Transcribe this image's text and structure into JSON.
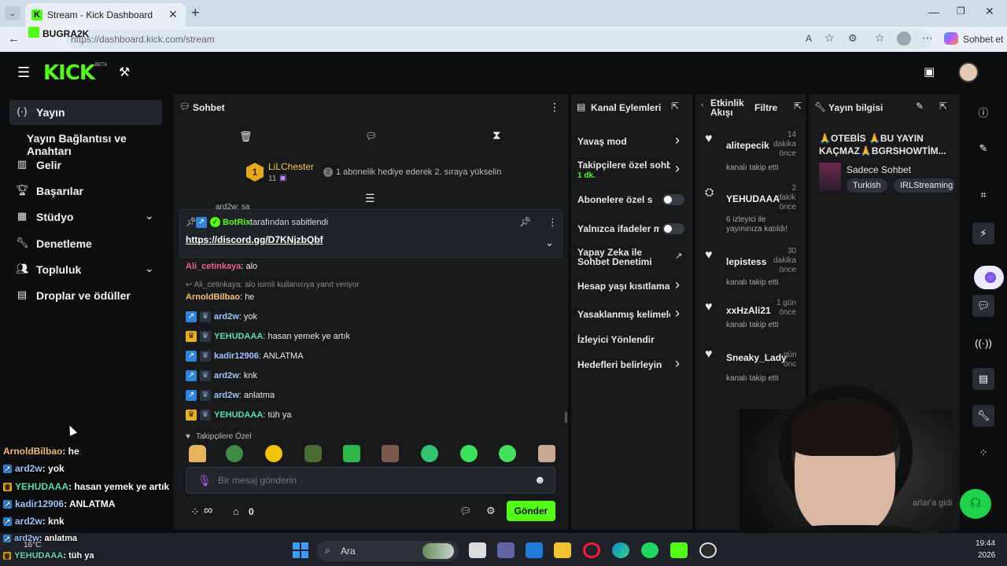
{
  "browser": {
    "tab_title": "Stream - Kick Dashboard",
    "url": "https://dashboard.kick.com/stream",
    "copilot_label": "Sohbet et",
    "overlay_name": "BUGRA2K"
  },
  "header": {
    "logo": "KICK",
    "logo_beta": "BETA"
  },
  "sidebar": {
    "items": [
      {
        "label": "Yayın",
        "icon": "broadcast-icon"
      },
      {
        "label": "Yayın Bağlantısı ve Anahtarı",
        "icon": ""
      },
      {
        "label": "Gelir",
        "icon": "chart-icon"
      },
      {
        "label": "Başarılar",
        "icon": "trophy-icon"
      },
      {
        "label": "Stüdyo",
        "icon": "studio-icon"
      },
      {
        "label": "Denetleme",
        "icon": "wrench-icon"
      },
      {
        "label": "Topluluk",
        "icon": "people-icon"
      },
      {
        "label": "Droplar ve ödüller",
        "icon": "gift-icon"
      }
    ]
  },
  "chat": {
    "title": "Sohbet",
    "leader_name": "LiLChester",
    "leader_rank": "1",
    "leader_count": "11",
    "leader_hint": "1 abonelik hediye ederek 2. sıraya yükselin",
    "leader_hint_badge": "2",
    "pinned_by": "BotRix",
    "pinned_suffix": "tarafından sabitlendi",
    "pinned_link": "https://discord.gg/D7KNjzbQbf",
    "partial_line": "ard2w: sa",
    "messages": [
      {
        "user": "Ali_cetinkaya",
        "text": "alo",
        "color": "#f06292",
        "badges": []
      },
      {
        "reply": "Ali_cetinkaya: alo isimli kullanıcıya yanıt veriyor"
      },
      {
        "user": "ArnoldBilbao",
        "text": "he",
        "color": "#f5c06a",
        "badges": []
      },
      {
        "user": "ard2w",
        "text": "yok",
        "color": "#9fc4ff",
        "badges": [
          "bot",
          "dim"
        ]
      },
      {
        "user": "YEHUDAAA",
        "text": "hasan yemek ye artık",
        "color": "#53e0b2",
        "badges": [
          "crown",
          "dim"
        ]
      },
      {
        "user": "kadir12906",
        "text": "ANLATMA",
        "color": "#9fc4ff",
        "badges": [
          "bot",
          "dim"
        ]
      },
      {
        "user": "ard2w",
        "text": "knk",
        "color": "#9fc4ff",
        "badges": [
          "bot",
          "dim"
        ]
      },
      {
        "user": "ard2w",
        "text": "anlatma",
        "color": "#9fc4ff",
        "badges": [
          "bot",
          "dim"
        ]
      },
      {
        "user": "YEHUDAAA",
        "text": "tüh ya",
        "color": "#53e0b2",
        "badges": [
          "crown",
          "dim"
        ]
      }
    ],
    "followers_only": "Takipçilere Özel",
    "input_placeholder": "Bir mesaj gönderin",
    "kicks_count": "0",
    "send_label": "Gönder",
    "infinity": "∞"
  },
  "actions": {
    "title": "Kanal Eylemleri",
    "items": [
      {
        "label": "Yavaş mod",
        "control": "chevron"
      },
      {
        "label": "Takipçilere özel sohbet",
        "sub": "1 dk.",
        "control": "chevron"
      },
      {
        "label": "Abonelere özel sohbet",
        "control": "toggle"
      },
      {
        "label": "Yalnızca ifadeler modu",
        "control": "toggle"
      },
      {
        "label": "Yapay Zeka ile Sohbet Denetimi",
        "control": "external"
      },
      {
        "label": "Hesap yaşı kısıtlaması",
        "control": "chevron"
      },
      {
        "label": "Yasaklanmış kelimeler",
        "control": "chevron"
      },
      {
        "label": "İzleyici Yönlendir",
        "control": "none"
      },
      {
        "label": "Hedefleri belirleyin",
        "control": "chevron"
      }
    ]
  },
  "activity": {
    "title": "Etkinlik Akışı",
    "filter": "Filtre",
    "items": [
      {
        "name": "alitepecik",
        "sub": "kanalı takip etti",
        "time": "14 dakika önce",
        "icon": "heart-icon"
      },
      {
        "name": "YEHUDAAA",
        "sub": "6 izleyici ile yayınınıza katıldı!",
        "sub_highlight": "6",
        "time": "2 dakika önce",
        "icon": "raid-icon"
      },
      {
        "name": "lepistess",
        "sub": "kanalı takip etti",
        "time": "30 dakika önce",
        "icon": "heart-icon"
      },
      {
        "name": "xxHzAli21",
        "sub": "kanalı takip etti",
        "time": "1 gün önce",
        "icon": "heart-icon"
      },
      {
        "name": "Sneaky_Lady",
        "sub": "kanalı takip etti",
        "time": "gün önce",
        "icon": "heart-icon"
      }
    ]
  },
  "stream_info": {
    "title": "Yayın bilgisi",
    "stream_title": "🙏OTEBİS 🙏BU YAYIN KAÇMAZ🙏BGRSHOWTİM...",
    "category": "Sadece Sohbet",
    "tags": [
      "Turkish",
      "IRLStreaming"
    ]
  },
  "overlay_chat": [
    {
      "user": "ArnoldBilbao",
      "text": ": he",
      "color": "#f5c06a"
    },
    {
      "user": "ard2w",
      "text": ": yok",
      "color": "#9fc4ff"
    },
    {
      "user": "YEHUDAAA",
      "text": ": hasan yemek ye artık",
      "color": "#53e0b2"
    },
    {
      "user": "kadir12906",
      "text": ": ANLATMA",
      "color": "#9fc4ff"
    },
    {
      "user": "ard2w",
      "text": ": knk",
      "color": "#9fc4ff"
    },
    {
      "user": "ard2w",
      "text": ": anlatma",
      "color": "#9fc4ff"
    },
    {
      "user": "YEHUDAAA",
      "text": ": tüh ya",
      "color": "#53e0b2"
    }
  ],
  "overlay_partial": "arlar'a gidi",
  "taskbar": {
    "search": "Ara",
    "weather": "16°C",
    "time": "19:44",
    "date": "2026"
  },
  "colors": {
    "kick_green": "#53fc18",
    "panel": "#17191b",
    "background": "#0b0d0e"
  }
}
